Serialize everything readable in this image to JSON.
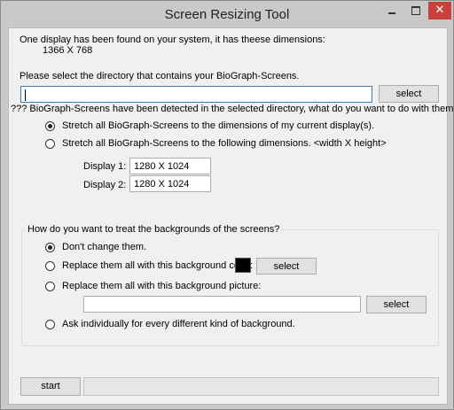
{
  "window": {
    "title": "Screen Resizing Tool",
    "close_glyph": "✕"
  },
  "display_info": {
    "message": "One display has been found on your system, it has theese dimensions:",
    "dimensions": "1366 X 768"
  },
  "directory": {
    "label": "Please select the directory that contains your BioGraph-Screens.",
    "value": "",
    "select_label": "select"
  },
  "detection": {
    "message": "???  BioGraph-Screens have been detected in the selected directory, what do you want to do with them?"
  },
  "resize_options": {
    "stretch_current": "Stretch all BioGraph-Screens to the dimensions of my current display(s).",
    "stretch_custom": "Stretch all BioGraph-Screens to the following dimensions. <width X height>",
    "display1_label": "Display 1:",
    "display1_value": "1280 X 1024",
    "display2_label": "Display 2:",
    "display2_value": "1280 X 1024"
  },
  "backgrounds": {
    "title": "How do you want to treat the backgrounds of the screens?",
    "dont_change": "Don't change them.",
    "replace_color": "Replace them all with this background color:",
    "color_value": "#000000",
    "color_select_label": "select",
    "replace_picture": "Replace them all with this background picture:",
    "picture_value": "",
    "picture_select_label": "select",
    "ask_individually": "Ask individually for every different kind of background."
  },
  "footer": {
    "start_label": "start",
    "progress_percent": 0
  }
}
